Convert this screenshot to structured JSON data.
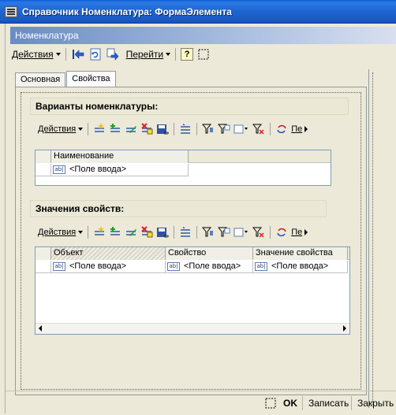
{
  "window": {
    "title": "Справочник Номенклатура: ФормаЭлемента"
  },
  "header": {
    "title": "Номенклатура"
  },
  "toolbar": {
    "actions_label": "Действия",
    "goto_label": "Перейти",
    "help_label": "?"
  },
  "tabs": [
    {
      "label": "Основная",
      "active": false
    },
    {
      "label": "Свойства",
      "active": true
    }
  ],
  "variants": {
    "title": "Варианты номенклатуры:",
    "toolbar": {
      "actions_label": "Действия",
      "more_label": "Пе"
    },
    "columns": [
      "Наименование"
    ],
    "rows": [
      [
        "<Поле ввода>"
      ]
    ]
  },
  "properties": {
    "title": "Значения свойств:",
    "toolbar": {
      "actions_label": "Действия",
      "more_label": "Пе"
    },
    "columns": [
      "Объект",
      "Свойство",
      "Значение свойства"
    ],
    "rows": [
      [
        "<Поле ввода>",
        "<Поле ввода>",
        "<Поле ввода>"
      ]
    ]
  },
  "footer": {
    "ok_label": "OK",
    "save_label": "Записать",
    "close_label": "Закрыть"
  },
  "colors": {
    "titlebar": "#1f64d0",
    "header_band": "#6a8cc4",
    "face": "#ece9d8"
  },
  "icons": [
    "app-icon",
    "back-icon",
    "refresh-icon",
    "forward-icon",
    "help-icon",
    "select-icon"
  ]
}
